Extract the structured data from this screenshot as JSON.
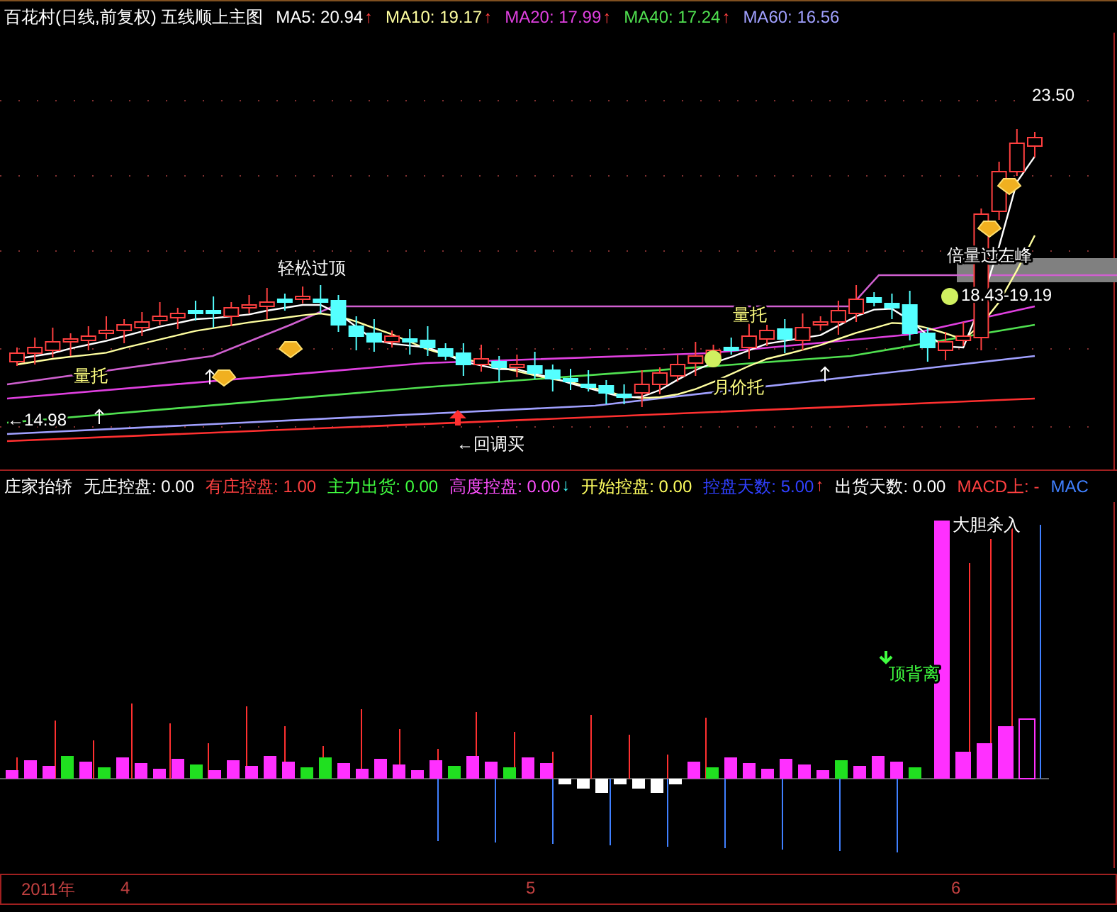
{
  "main_legend": {
    "title": "百花村(日线,前复权) 五线顺上主图",
    "items": [
      {
        "label": "MA5: 20.94",
        "color": "#ffffff",
        "arrow": {
          "text": "↑",
          "kind": "up"
        }
      },
      {
        "label": "MA10: 19.17",
        "color": "#ffffa0",
        "arrow": {
          "text": "↑",
          "kind": "up"
        }
      },
      {
        "label": "MA20: 17.99",
        "color": "#e040e0",
        "arrow": {
          "text": "↑",
          "kind": "up"
        }
      },
      {
        "label": "MA40: 17.24",
        "color": "#50e050",
        "arrow": {
          "text": "↑",
          "kind": "up"
        }
      },
      {
        "label": "MA60: 16.56",
        "color": "#a0a0ff"
      }
    ]
  },
  "main_annotations": [
    {
      "text": "23.50",
      "color": "#ffffff"
    },
    {
      "text": "倍量过左峰",
      "color": "#ffffff"
    },
    {
      "text": "18.43-19.19",
      "color": "#ffffff"
    },
    {
      "text": "轻松过顶",
      "color": "#ffffff"
    },
    {
      "text": "量托",
      "color": "#ffff80"
    },
    {
      "text": "量托",
      "color": "#ffff80"
    },
    {
      "text": "月价托",
      "color": "#ffff80"
    },
    {
      "text": "←14.98",
      "color": "#ffffff"
    },
    {
      "text": "←回调买",
      "color": "#ffffff"
    }
  ],
  "indicator_legend": {
    "title": "庄家抬轿",
    "items": [
      {
        "label": "无庄控盘: 0.00",
        "color": "#ffffff"
      },
      {
        "label": "有庄控盘: 1.00",
        "color": "#ff4040"
      },
      {
        "label": "主力出货: 0.00",
        "color": "#40ff40"
      },
      {
        "label": "高度控盘: 0.00",
        "color": "#ff50ff",
        "arrow": {
          "text": "↓",
          "kind": "down"
        }
      },
      {
        "label": "开始控盘: 0.00",
        "color": "#ffff60"
      },
      {
        "label": "控盘天数: 5.00",
        "color": "#3040ff",
        "arrow": {
          "text": "↑",
          "kind": "up"
        }
      },
      {
        "label": "出货天数: 0.00",
        "color": "#ffffff"
      },
      {
        "label": "MACD上: -",
        "color": "#ff4040"
      },
      {
        "label": "MAC",
        "color": "#4080ff"
      }
    ]
  },
  "indicator_annotations": [
    {
      "text": "顶背离",
      "color": "#40ff40"
    },
    {
      "text": "大胆杀入",
      "color": "#ffffff"
    }
  ],
  "time_axis": [
    "2011年",
    "4",
    "5",
    "6"
  ]
}
